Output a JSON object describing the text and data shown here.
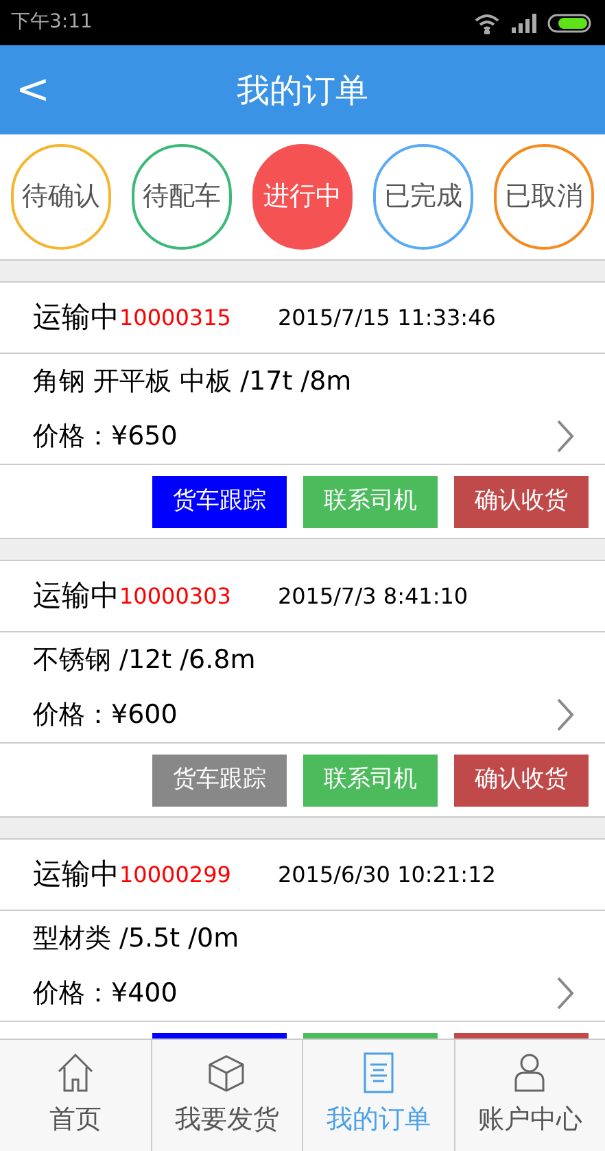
{
  "status_bar": {
    "time": "下午3:11"
  },
  "header": {
    "back": "<",
    "title": "我的订单"
  },
  "filters": [
    {
      "label": "待确认",
      "color": "#f5b52e",
      "selected": false
    },
    {
      "label": "待配车",
      "color": "#3cb878",
      "selected": false
    },
    {
      "label": "进行中",
      "color": "#f55353",
      "selected": true
    },
    {
      "label": "已完成",
      "color": "#5aaaf5",
      "selected": false
    },
    {
      "label": "已取消",
      "color": "#f58a1e",
      "selected": false
    }
  ],
  "orders": [
    {
      "status": "运输中",
      "number": "10000315",
      "date": "2015/7/15 11:33:46",
      "goods": "角钢 开平板 中板 /17t /8m",
      "price": "价格：¥650",
      "buttons": [
        {
          "label": "货车跟踪",
          "color": "#0000ff"
        },
        {
          "label": "联系司机",
          "color": "#4cbb5c"
        },
        {
          "label": "确认收货",
          "color": "#c04a4a"
        }
      ]
    },
    {
      "status": "运输中",
      "number": "10000303",
      "date": "2015/7/3 8:41:10",
      "goods": "不锈钢 /12t /6.8m",
      "price": "价格：¥600",
      "buttons": [
        {
          "label": "货车跟踪",
          "color": "#888888"
        },
        {
          "label": "联系司机",
          "color": "#4cbb5c"
        },
        {
          "label": "确认收货",
          "color": "#c04a4a"
        }
      ]
    },
    {
      "status": "运输中",
      "number": "10000299",
      "date": "2015/6/30 10:21:12",
      "goods": "型材类 /5.5t /0m",
      "price": "价格：¥400",
      "buttons": [
        {
          "color": "#0000ff"
        },
        {
          "color": "#4cbb5c"
        },
        {
          "color": "#c04a4a"
        }
      ]
    }
  ],
  "tab_bar": [
    {
      "label": "首页",
      "kind": "home",
      "selected": false
    },
    {
      "label": "我要发货",
      "kind": "box",
      "selected": false
    },
    {
      "label": "我的订单",
      "kind": "document",
      "selected": true
    },
    {
      "label": "账户中心",
      "kind": "person",
      "selected": false
    }
  ]
}
